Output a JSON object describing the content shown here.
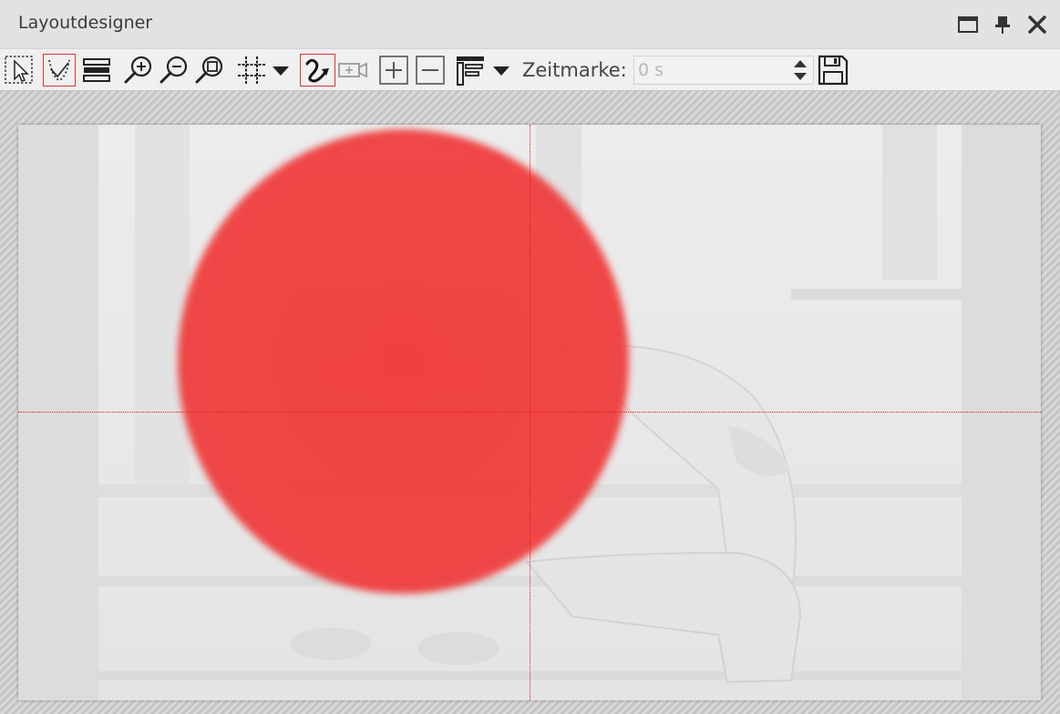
{
  "window": {
    "title": "Layoutdesigner",
    "icons": [
      "maximize-icon",
      "pin-icon",
      "close-icon"
    ]
  },
  "toolbar": {
    "tools": [
      {
        "name": "select-tool",
        "icon": "dotted-arrow-selection-icon",
        "active": false
      },
      {
        "name": "curve-points-tool",
        "icon": "dotted-curve-icon",
        "active": true
      },
      {
        "name": "layers-tool",
        "icon": "layers-stack-icon",
        "active": false
      },
      {
        "name": "zoom-in-tool",
        "icon": "zoom-in-icon",
        "active": false
      },
      {
        "name": "zoom-out-tool",
        "icon": "zoom-out-icon",
        "active": false
      },
      {
        "name": "zoom-fit-tool",
        "icon": "zoom-fit-icon",
        "active": false
      },
      {
        "name": "grid-tool",
        "icon": "grid-icon",
        "active": false
      },
      {
        "name": "motion-path-tool",
        "icon": "motion-path-icon",
        "active": true
      },
      {
        "name": "camera-tool",
        "icon": "camera-icon",
        "active": false,
        "disabled": true
      },
      {
        "name": "add-point-tool",
        "icon": "plus-box-icon",
        "active": false
      },
      {
        "name": "remove-point-tool",
        "icon": "minus-box-icon",
        "active": false
      },
      {
        "name": "align-tool",
        "icon": "align-icon",
        "active": false
      },
      {
        "name": "save-tool",
        "icon": "floppy-disk-icon",
        "active": false
      }
    ],
    "zeitmarke": {
      "label": "Zeitmarke:",
      "value": "0 s"
    }
  },
  "colors": {
    "accent_red": "#e01818",
    "blob_red": "#f03333",
    "active_border": "#dd3333"
  }
}
